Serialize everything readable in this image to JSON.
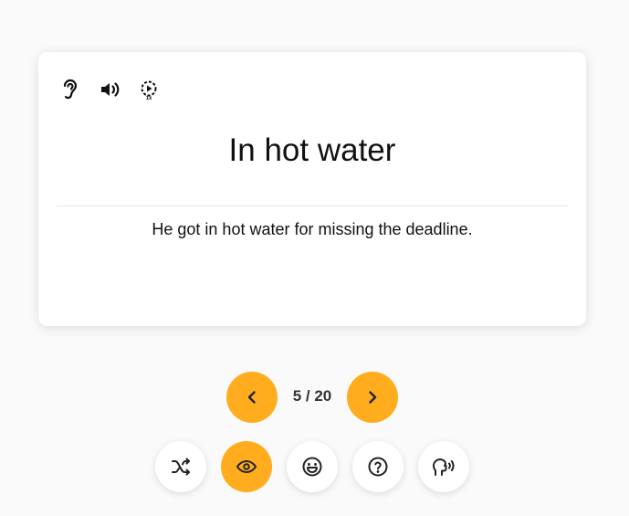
{
  "card": {
    "term": "In hot water",
    "example": "He got in hot water for missing the deadline.",
    "icons": {
      "listen": "ear-icon",
      "speaker": "speaker-icon",
      "speed": "playback-speed-icon",
      "speed_label": "1x"
    }
  },
  "navigation": {
    "counter": "5 / 20",
    "prev_icon": "chevron-left-icon",
    "next_icon": "chevron-right-icon"
  },
  "actions": {
    "icons": [
      "shuffle-icon",
      "eye-icon",
      "smile-icon",
      "question-icon",
      "speak-icon"
    ]
  },
  "colors": {
    "accent": "#ffad1f",
    "background": "#fafafa",
    "card": "#ffffff"
  }
}
